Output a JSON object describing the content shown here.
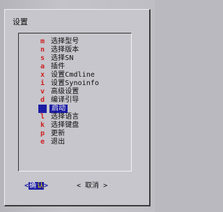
{
  "dialog": {
    "title": "设置"
  },
  "menu": {
    "items": [
      {
        "key": "m",
        "label": "选择型号"
      },
      {
        "key": "n",
        "label": "选择版本"
      },
      {
        "key": "s",
        "label": "选择SN"
      },
      {
        "key": "a",
        "label": "插件"
      },
      {
        "key": "x",
        "label": "设置Cmdline"
      },
      {
        "key": "i",
        "label": "设置Synoinfo"
      },
      {
        "key": "v",
        "label": "高级设置"
      },
      {
        "key": "d",
        "label": "编译引导"
      },
      {
        "key": "b",
        "label": "启动",
        "selected": true
      },
      {
        "key": "l",
        "label": "选择语言"
      },
      {
        "key": "k",
        "label": "选择键盘"
      },
      {
        "key": "p",
        "label": "更新"
      },
      {
        "key": "e",
        "label": "退出"
      }
    ]
  },
  "buttons": {
    "ok": {
      "left": "<",
      "label_start": "确",
      "label_key": "认",
      "right": ">"
    },
    "cancel": {
      "left": "<",
      "label": " 取消 ",
      "right": ">"
    }
  },
  "colors": {
    "dialog_bg": "#c6c6cc",
    "selection": "#1c1ca4",
    "hotkey": "#cf1f1f",
    "button_hotkey": "#f4d800"
  }
}
